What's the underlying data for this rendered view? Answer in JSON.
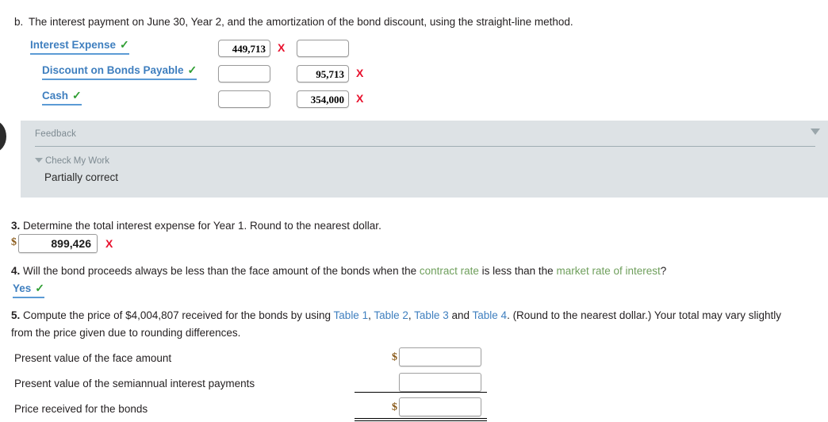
{
  "part_b": {
    "label": "b.",
    "text": "The interest payment on June 30, Year 2, and the amortization of the bond discount, using the straight-line method."
  },
  "journal_entry": {
    "rows": [
      {
        "account": "Interest Expense",
        "status_icon": "check-icon",
        "check": "✓",
        "debit": "449,713",
        "credit": "",
        "debit_mark": "X",
        "credit_mark": ""
      },
      {
        "account": "Discount on Bonds Payable",
        "status_icon": "check-icon",
        "check": "✓",
        "debit": "",
        "credit": "95,713",
        "debit_mark": "",
        "credit_mark": "X"
      },
      {
        "account": "Cash",
        "status_icon": "check-icon",
        "check": "✓",
        "debit": "",
        "credit": "354,000",
        "debit_mark": "",
        "credit_mark": "X"
      }
    ]
  },
  "feedback": {
    "title": "Feedback",
    "collapse_icon": "triangle-down-icon",
    "check_my_work": "Check My Work",
    "check_my_work_icon": "triangle-down-icon",
    "result": "Partially correct"
  },
  "question3": {
    "number": "3.",
    "text": "Determine the total interest expense for Year 1. Round to the nearest dollar.",
    "dollar_sign": "$",
    "value": "899,426",
    "mark": "X"
  },
  "question4": {
    "number": "4.",
    "text_part1": "Will the bond proceeds always be less than the face amount of the bonds when the ",
    "glossary1": "contract rate",
    "text_part2": " is less than the ",
    "glossary2": "market rate of interest",
    "text_part3": "?",
    "answer": "Yes",
    "check": "✓"
  },
  "question5": {
    "number": "5.",
    "text_part1": "Compute the price of $4,004,807 received for the bonds by using ",
    "link1": "Table 1",
    "sep1": ", ",
    "link2": "Table 2",
    "sep2": ", ",
    "link3": "Table 3",
    "sep3": " and ",
    "link4": "Table 4",
    "text_part2": ". (Round to the nearest dollar.) Your total may vary slightly",
    "text_line2": "from the price given due to rounding differences.",
    "rows": [
      {
        "label": "Present value of the face amount",
        "dollar_sign": "$",
        "value": ""
      },
      {
        "label": "Present value of the semiannual interest payments",
        "dollar_sign": "",
        "value": ""
      },
      {
        "label": "Price received for the bonds",
        "dollar_sign": "$",
        "value": ""
      }
    ]
  },
  "colors": {
    "link_blue": "#3f7fbf",
    "glossary_green": "#6f9f5c",
    "error_red": "#e8112d",
    "check_green": "#2e9e32",
    "feedback_bg": "#dde2e5",
    "dollar_brown": "#8a5a1a"
  }
}
